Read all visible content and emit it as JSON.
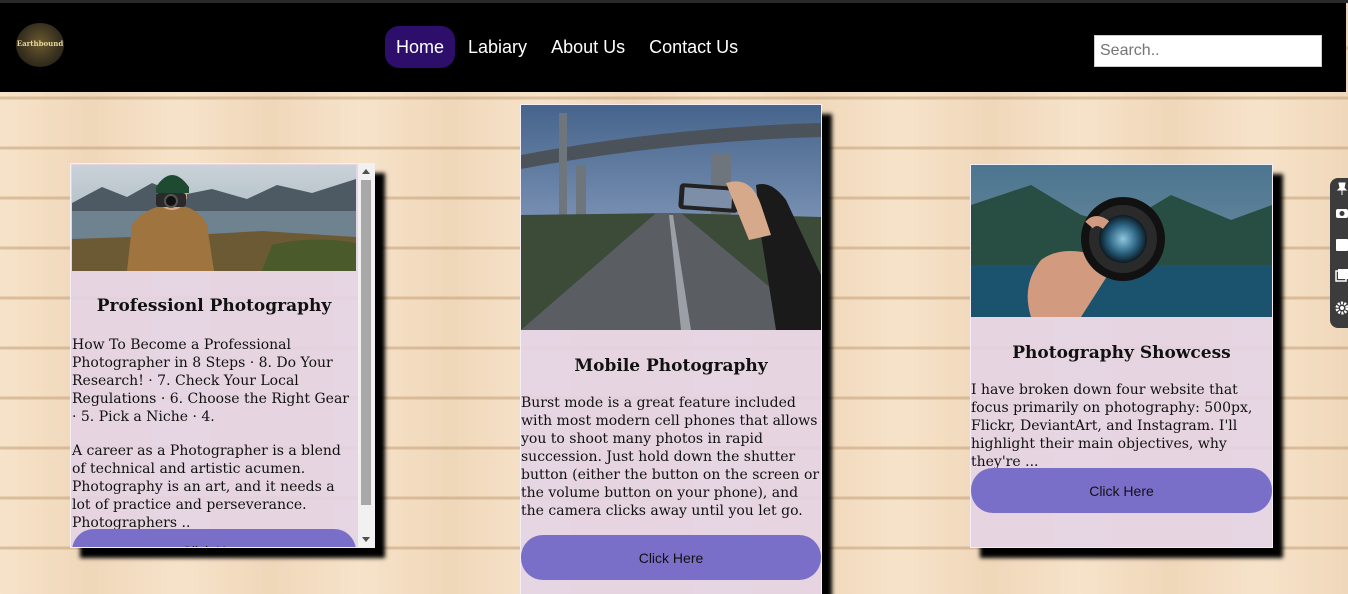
{
  "brand": {
    "logo_text": "Earthbound"
  },
  "nav": {
    "links": [
      {
        "label": "Home",
        "active": true
      },
      {
        "label": "Labiary",
        "active": false
      },
      {
        "label": "About Us",
        "active": false
      },
      {
        "label": "Contact Us",
        "active": false
      }
    ]
  },
  "search": {
    "placeholder": "Search.."
  },
  "cards": [
    {
      "title": "Professionl Photography",
      "paragraphs": [
        "How To Become a Professional Photographer in 8 Steps · 8. Do Your Research! · 7. Check Your Local Regulations · 6. Choose the Right Gear · 5. Pick a Niche · 4.",
        "A career as a Photographer is a blend of technical and artistic acumen. Photography is an art, and it needs a lot of practice and perseverance. Photographers .."
      ],
      "button_label": "Click Here"
    },
    {
      "title": "Mobile Photography",
      "paragraphs": [
        "Burst mode is a great feature included with most modern cell phones that allows you to shoot many photos in rapid succession. Just hold down the shutter button (either the button on the screen or the volume button on your phone), and the camera clicks away until you let go."
      ],
      "button_label": "Click Here"
    },
    {
      "title": "Photography Showcess",
      "paragraphs": [
        "I have broken down four website that focus primarily on photography: 500px, Flickr, DeviantArt, and Instagram. I'll highlight their main objectives, why they're ..."
      ],
      "button_label": "Click Here"
    }
  ],
  "colors": {
    "nav_bg": "#000000",
    "nav_active": "#2d0f6b",
    "button": "#7a6fc8",
    "card_bg": "#e4d4e4"
  },
  "icons": [
    "pin-icon",
    "camera-icon",
    "square-icon",
    "gallery-icon",
    "gear-icon"
  ]
}
